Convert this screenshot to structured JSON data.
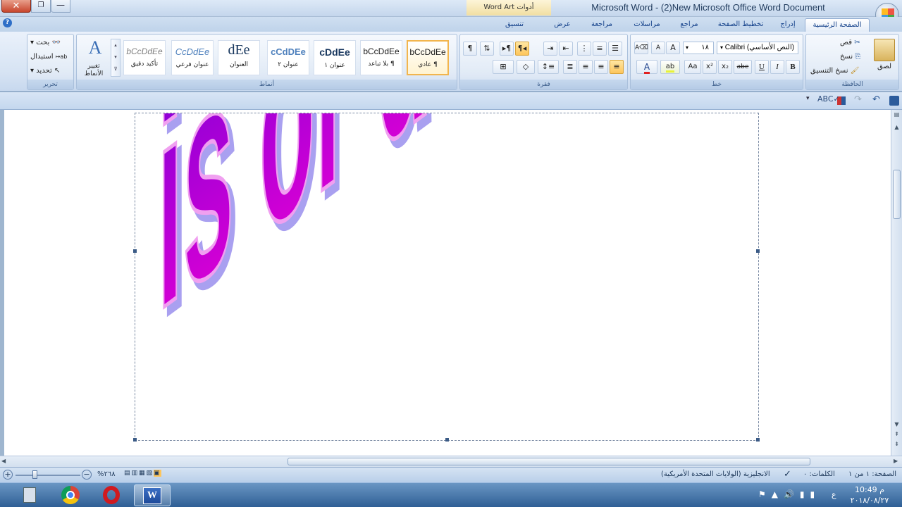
{
  "window": {
    "title": "Microsoft Word - (2)New Microsoft Office Word Document",
    "close_symbol": "✕",
    "maximize_symbol": "❐",
    "minimize_symbol": "—",
    "contextual_tab_group": "أدوات Word Art"
  },
  "tabs": {
    "home": "الصفحة الرئيسية",
    "insert": "إدراج",
    "page_layout": "تخطيط الصفحة",
    "references": "مراجع",
    "mailings": "مراسلات",
    "review": "مراجعة",
    "view": "عرض",
    "format": "تنسيق"
  },
  "clipboard": {
    "paste": "لصق",
    "cut": "قص",
    "copy": "نسخ",
    "format_painter": "نسخ التنسيق",
    "group_label": "الحافظة"
  },
  "font": {
    "font_name": "Calibri (النص الأساسي)",
    "font_size": "١٨",
    "group_label": "خط",
    "bold": "B",
    "italic": "I",
    "underline": "U",
    "strike": "abe",
    "subscript": "x₂",
    "superscript": "x²",
    "change_case": "Aa",
    "grow": "A",
    "shrink": "A"
  },
  "paragraph": {
    "group_label": "فقرة"
  },
  "styles": {
    "group_label": "أنماط",
    "change_styles": "تغيير الأنماط",
    "items": [
      {
        "preview": "bCcDdEe",
        "name": "¶ عادي"
      },
      {
        "preview": "bCcDdEe",
        "name": "¶ بلا تباعد"
      },
      {
        "preview": "cDdEe",
        "name": "عنوان ١"
      },
      {
        "preview": "cCdDEe",
        "name": "عنوان ٢"
      },
      {
        "preview": "dEe",
        "name": "العنوان"
      },
      {
        "preview": "CcDdEe",
        "name": "عنوان فرعي"
      },
      {
        "preview": "bCcDdEe",
        "name": "تأكيد دقيق"
      }
    ]
  },
  "editing": {
    "find": "بحث",
    "replace": "استبدال",
    "select": "تحديد",
    "group_label": "تحرير"
  },
  "wordart": {
    "text": "is or does !!!!",
    "fill_top": "#7a00d8",
    "fill_bottom": "#e600d4",
    "shadow": "#a9a0f0"
  },
  "status": {
    "page": "الصفحة: ١ من ١",
    "words": "الكلمات: ٠",
    "language": "الانجليزية (الولايات المتحدة الأمريكية)",
    "zoom": "%٢٦٨"
  },
  "taskbar": {
    "time": "10:49 م",
    "date": "٢٠١٨/٠٨/٢٧",
    "lang": "ع"
  }
}
